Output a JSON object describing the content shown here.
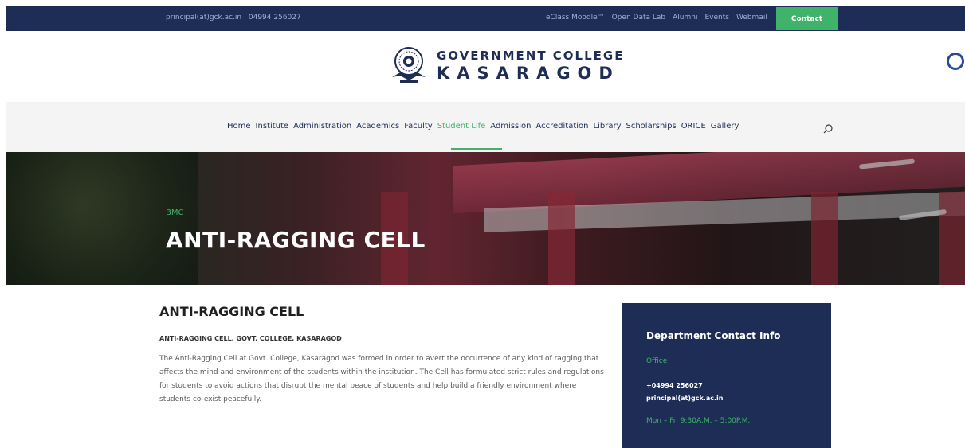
{
  "topbar": {
    "contact_info": "principal(at)gck.ac.in | 04994 256027",
    "links": [
      "eClass Moodle™",
      "Open Data Lab",
      "Alumni",
      "Events",
      "Webmail"
    ],
    "contact_button": "Contact",
    "background_color": "#1e2d55",
    "accent_color": "#3fb36a"
  },
  "header": {
    "logo_line1": "GOVERNMENT COLLEGE",
    "logo_line2": "KASARAGOD",
    "logo_icon": "college-seal-icon"
  },
  "nav": {
    "items": [
      "Home",
      "Institute",
      "Administration",
      "Academics",
      "Faculty",
      "Student Life",
      "Admission",
      "Accreditation",
      "Library",
      "Scholarships",
      "ORICE",
      "Gallery"
    ],
    "active": "Student Life",
    "search_icon": "search-icon"
  },
  "hero": {
    "breadcrumb": "BMC",
    "title": "ANTI-RAGGING CELL"
  },
  "main": {
    "heading": "ANTI-RAGGING CELL",
    "subheading": "ANTI-RAGGING CELL, GOVT. COLLEGE, KASARAGOD",
    "paragraph": "The Anti-Ragging Cell at Govt. College, Kasaragod was formed in order to avert the occurrence of any kind of ragging that affects the mind and environment of the students within the institution. The Cell has formulated strict rules and regulations for students to avoid actions that disrupt the mental peace of students and help build a friendly environment where students co-exist peacefully."
  },
  "sidebar": {
    "title": "Department Contact Info",
    "office_label": "Office",
    "phone": "+04994 256027",
    "email": "principal(at)gck.ac.in",
    "hours": "Mon – Fri 9:30A.M. – 5:00P.M."
  }
}
